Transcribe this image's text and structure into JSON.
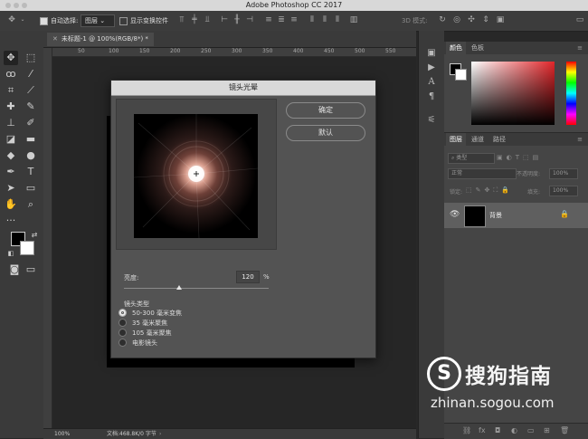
{
  "app": {
    "title": "Adobe Photoshop CC 2017"
  },
  "options_bar": {
    "auto_select_label": "自动选择:",
    "auto_select_value": "图层",
    "show_transform_label": "显示变换控件",
    "mode_3d_label": "3D 模式:"
  },
  "document": {
    "tab_label": "未标题-1 @ 100%(RGB/8*) *",
    "ruler_ticks": [
      "50",
      "100",
      "150",
      "200",
      "250",
      "300",
      "350",
      "400",
      "450",
      "500",
      "550"
    ],
    "status_zoom": "100%",
    "status_doc": "文档:468.8K/0 字节"
  },
  "color_panel": {
    "tabs": [
      "颜色",
      "色板"
    ]
  },
  "layers_panel": {
    "tabs": [
      "图层",
      "通道",
      "路径"
    ],
    "filter_label": "类型",
    "blend_mode": "正常",
    "opacity_label": "不透明度:",
    "opacity_value": "100%",
    "lock_label": "锁定:",
    "fill_label": "填充:",
    "fill_value": "100%",
    "layers": [
      {
        "name": "背景",
        "visible": true,
        "locked": true
      }
    ]
  },
  "dialog": {
    "title": "镜头光晕",
    "ok_label": "确定",
    "reset_label": "默认",
    "brightness_label": "亮度:",
    "brightness_value": "120",
    "brightness_unit": "%",
    "brightness_range": [
      10,
      300
    ],
    "lens_type_label": "镜头类型",
    "lens_types": [
      {
        "label": "50-300 毫米变焦",
        "selected": true
      },
      {
        "label": "35 毫米聚焦",
        "selected": false
      },
      {
        "label": "105 毫米聚焦",
        "selected": false
      },
      {
        "label": "电影镜头",
        "selected": false
      }
    ]
  },
  "watermark": {
    "brand": "搜狗指南",
    "url": "zhinan.sogou.com"
  },
  "colors": {
    "accent": "#d9d9d9",
    "panel": "#454545",
    "dialog": "#535353"
  }
}
